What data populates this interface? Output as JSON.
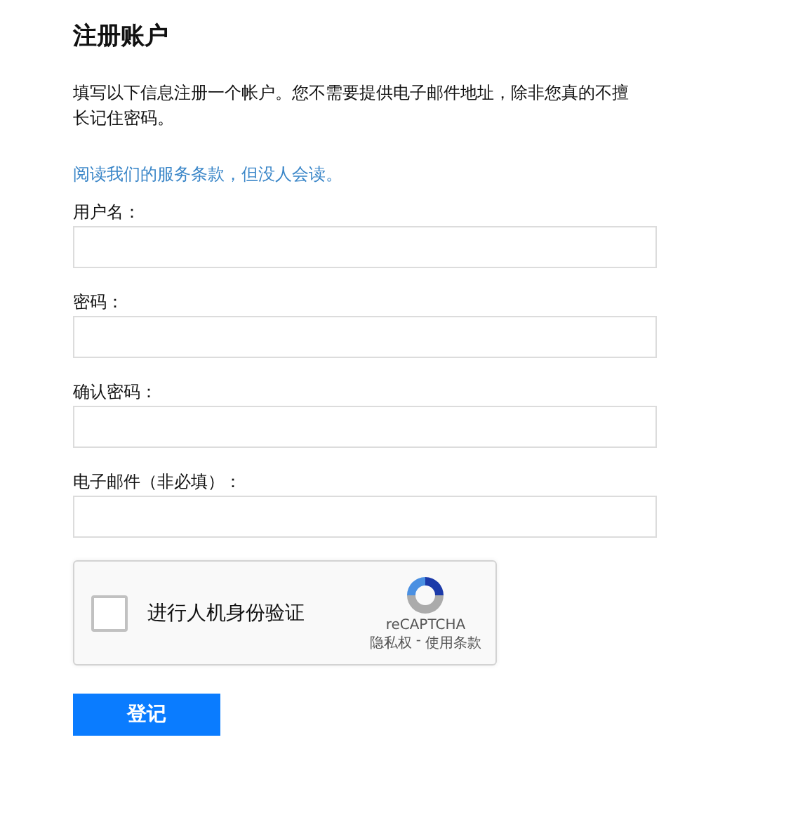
{
  "title": "注册账户",
  "intro": "填写以下信息注册一个帐户。您不需要提供电子邮件地址，除非您真的不擅长记住密码。",
  "terms_link": "阅读我们的服务条款，但没人会读。",
  "fields": [
    {
      "label": "用户名："
    },
    {
      "label": "密码："
    },
    {
      "label": "确认密码："
    },
    {
      "label": "电子邮件（非必填）："
    }
  ],
  "captcha": {
    "label": "进行人机身份验证",
    "checked": false,
    "brand": "reCAPTCHA",
    "privacy": "隐私权",
    "separator": "-",
    "terms": "使用条款"
  },
  "submit": "登记"
}
